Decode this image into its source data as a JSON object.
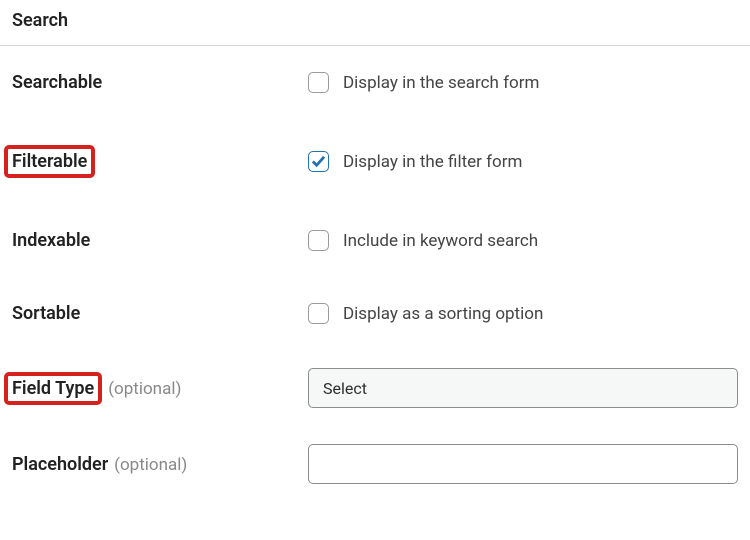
{
  "section": {
    "title": "Search"
  },
  "fields": {
    "searchable": {
      "label": "Searchable",
      "checkbox_label": "Display in the search form",
      "checked": false
    },
    "filterable": {
      "label": "Filterable",
      "checkbox_label": "Display in the filter form",
      "checked": true,
      "highlighted": true
    },
    "indexable": {
      "label": "Indexable",
      "checkbox_label": "Include in keyword search",
      "checked": false
    },
    "sortable": {
      "label": "Sortable",
      "checkbox_label": "Display as a sorting option",
      "checked": false
    },
    "field_type": {
      "label": "Field Type",
      "optional": "(optional)",
      "value": "Select",
      "highlighted": true
    },
    "placeholder": {
      "label": "Placeholder",
      "optional": "(optional)",
      "value": ""
    }
  }
}
